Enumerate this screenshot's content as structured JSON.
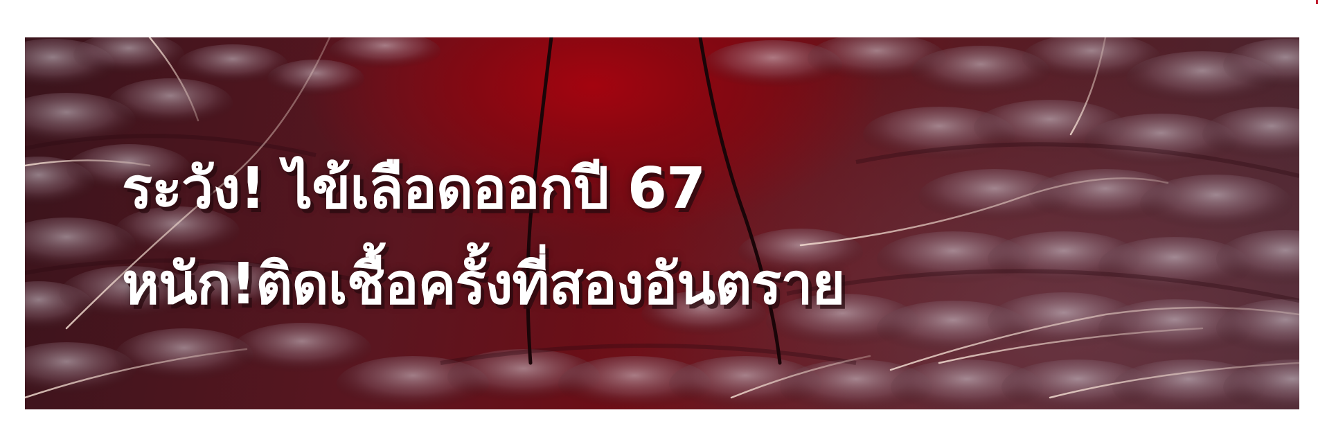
{
  "banner": {
    "headline_line1": "ระวัง! ไข้เลือดออกปี 67",
    "headline_line2": "หนัก!ติดเชื้อครั้งที่สองอันตราย"
  },
  "colors": {
    "background": "#ffffff",
    "banner_base": "#5a1620",
    "banner_highlight": "#a3040f",
    "text": "#ffffff",
    "accent": "#c0182b"
  },
  "icons": [
    "mosquito-skin-texture"
  ]
}
